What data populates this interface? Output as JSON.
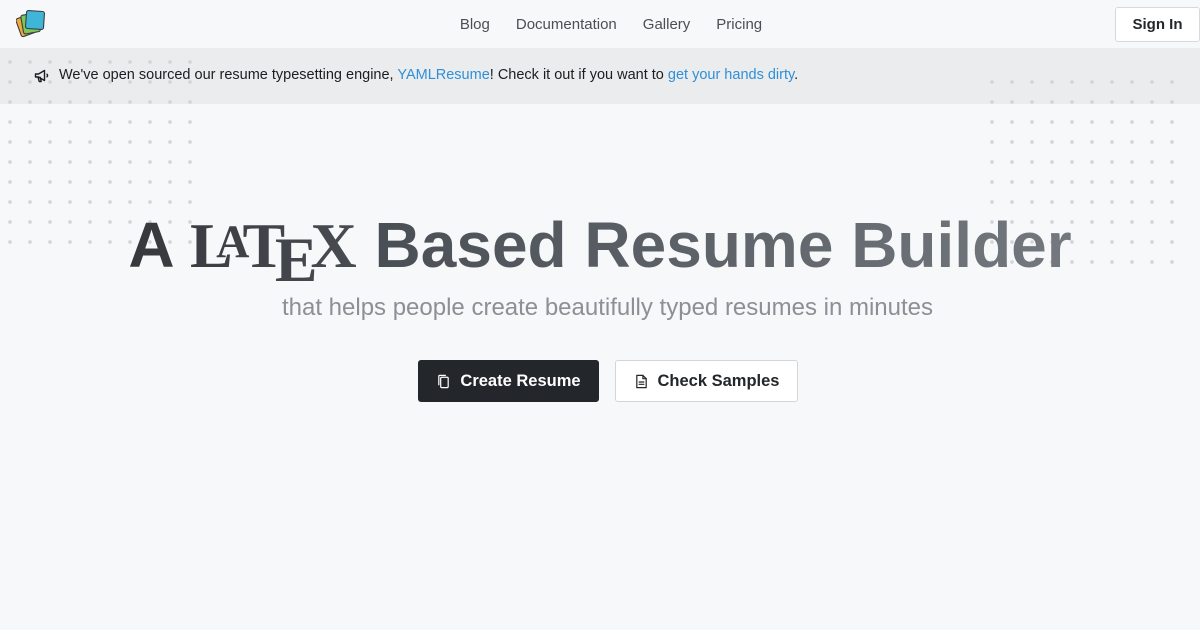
{
  "header": {
    "logo_icon": "layered-cards-logo",
    "nav": [
      {
        "label": "Blog"
      },
      {
        "label": "Documentation"
      },
      {
        "label": "Gallery"
      },
      {
        "label": "Pricing"
      }
    ],
    "signin_label": "Sign In"
  },
  "banner": {
    "icon": "megaphone-icon",
    "text_before": "We've open sourced our resume typesetting engine, ",
    "link1": "YAMLResume",
    "text_middle": "! Check it out if you want to ",
    "link2": "get your hands dirty",
    "text_after": "."
  },
  "hero": {
    "title_prefix": "A ",
    "latex": {
      "L": "L",
      "A": "A",
      "T": "T",
      "E": "E",
      "X": "X"
    },
    "title_suffix": " Based Resume Builder",
    "subtitle": "that helps people create beautifully typed resumes in minutes",
    "primary_button": {
      "label": "Create Resume",
      "icon": "copy-icon"
    },
    "secondary_button": {
      "label": "Check Samples",
      "icon": "document-icon"
    }
  },
  "colors": {
    "background": "#f7f8f9",
    "banner_background": "#ebecee",
    "link": "#2f8fd8",
    "primary_button": "#23262a"
  }
}
